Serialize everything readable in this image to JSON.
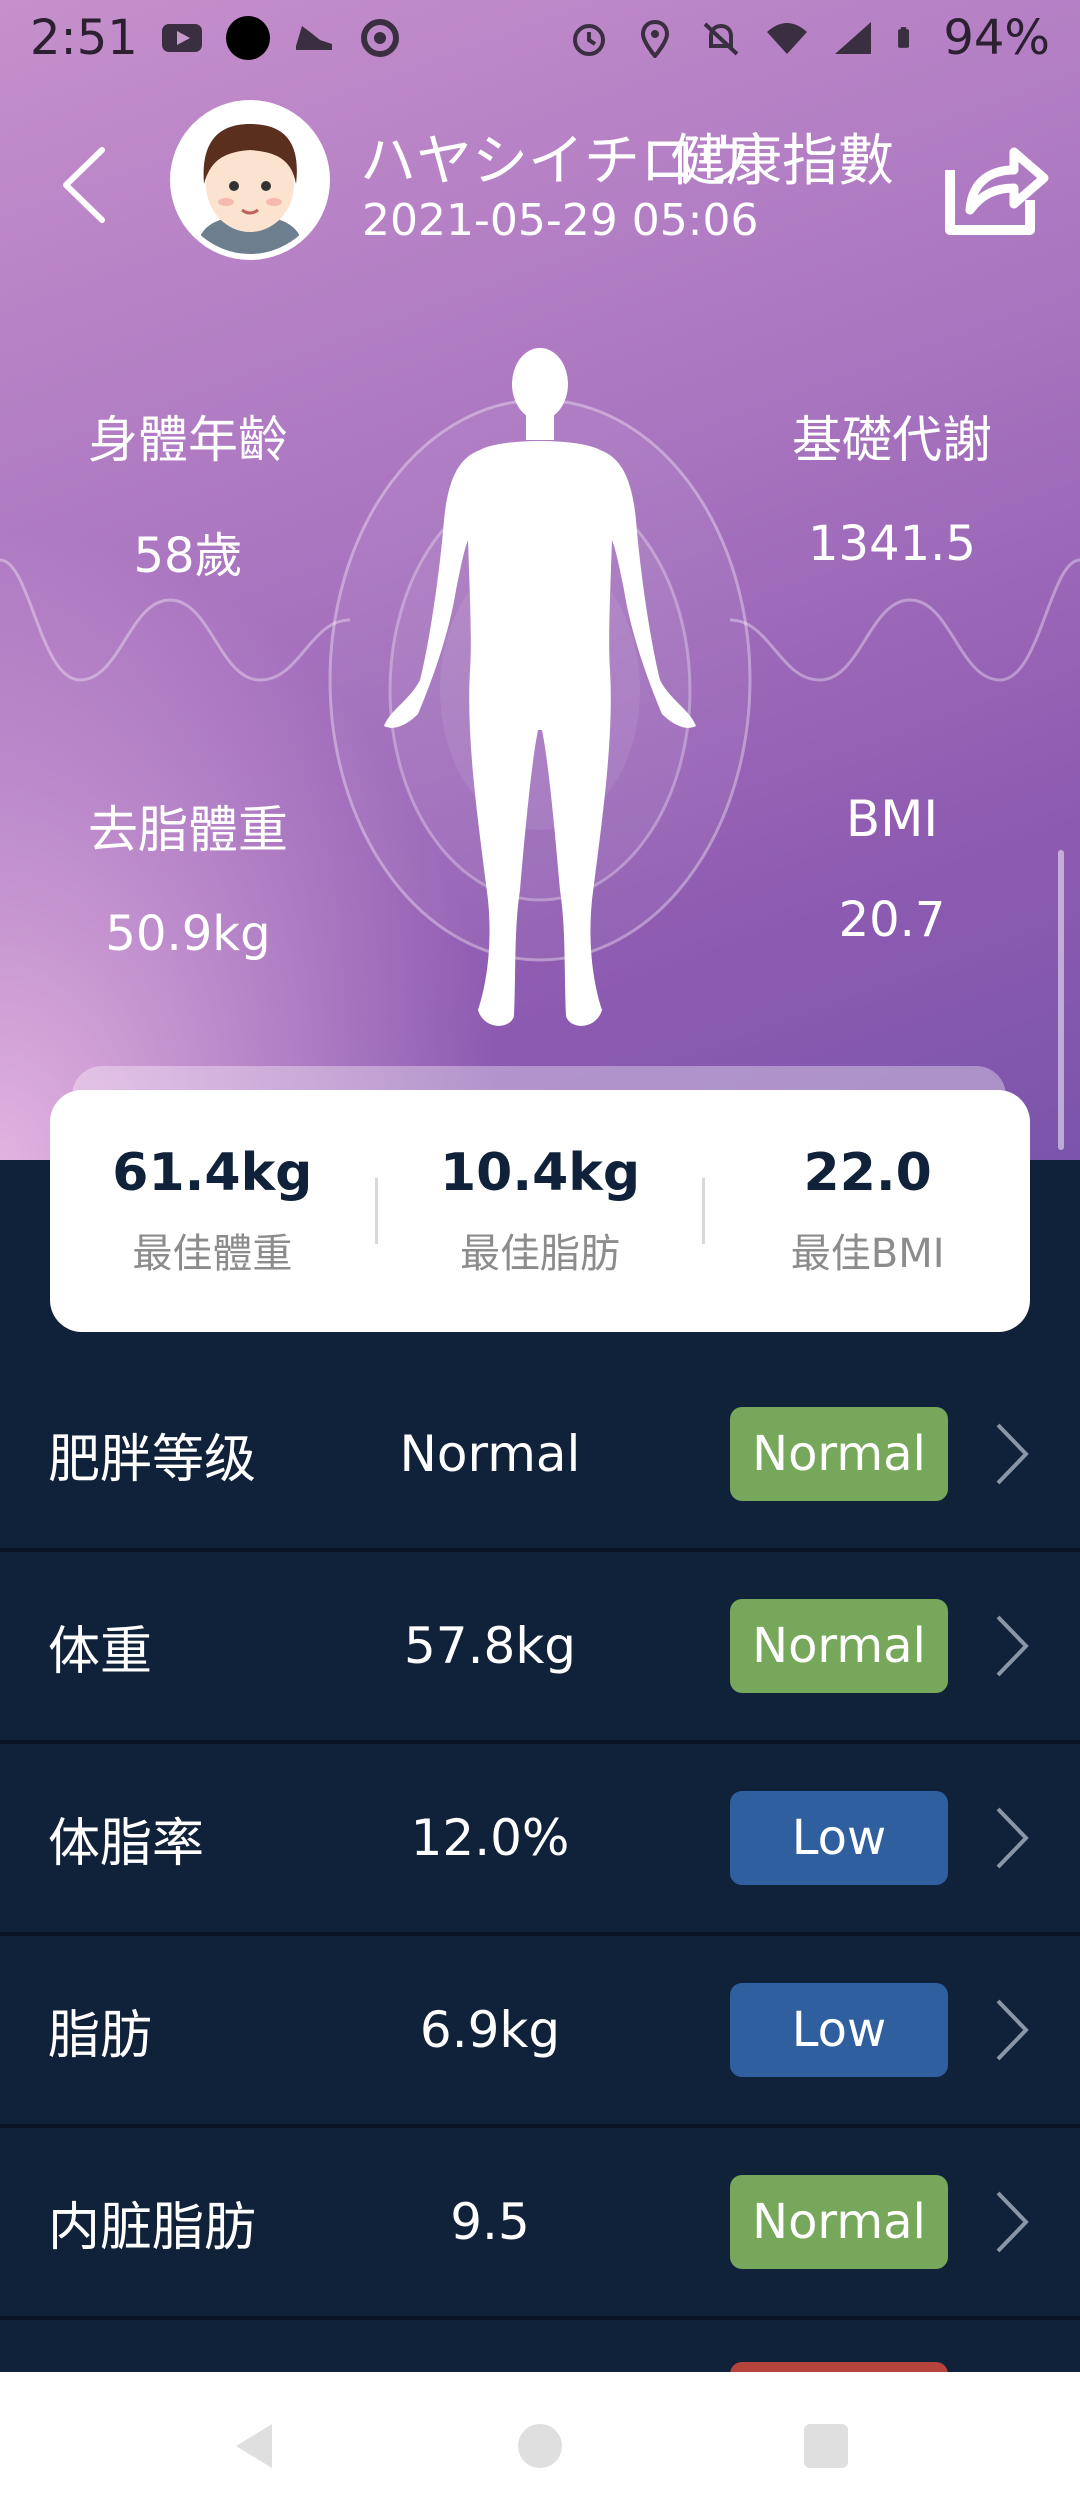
{
  "status_bar": {
    "time": "2:51",
    "battery": "94%",
    "left_icons": [
      "youtube-icon",
      "circle-icon",
      "shoe-icon",
      "sync-icon"
    ],
    "right_icons": [
      "alarm-icon",
      "location-icon",
      "mute-icon",
      "wifi-icon",
      "signal-icon",
      "battery-icon"
    ]
  },
  "header": {
    "user_name": "ハヤシイチロウ",
    "title": "健康指數",
    "timestamp": "2021-05-29 05:06"
  },
  "metrics": [
    {
      "label": "身體年齡",
      "value": "58歲"
    },
    {
      "label": "基礎代謝",
      "value": "1341.5"
    },
    {
      "label": "去脂體重",
      "value": "50.9kg"
    },
    {
      "label": "BMI",
      "value": "20.7"
    }
  ],
  "summary": [
    {
      "value": "61.4kg",
      "label": "最佳體重"
    },
    {
      "value": "10.4kg",
      "label": "最佳脂肪"
    },
    {
      "value": "22.0",
      "label": "最佳BMI"
    }
  ],
  "rows": [
    {
      "label": "肥胖等级",
      "value": "Normal",
      "status": "Normal"
    },
    {
      "label": "体重",
      "value": "57.8kg",
      "status": "Normal"
    },
    {
      "label": "体脂率",
      "value": "12.0%",
      "status": "Low"
    },
    {
      "label": "脂肪",
      "value": "6.9kg",
      "status": "Low"
    },
    {
      "label": "内脏脂肪",
      "value": "9.5",
      "status": "Normal"
    }
  ],
  "colors": {
    "normal": "#76a75a",
    "low": "#2f5f9f",
    "high": "#b7433d",
    "list_bg": "#10223a"
  }
}
